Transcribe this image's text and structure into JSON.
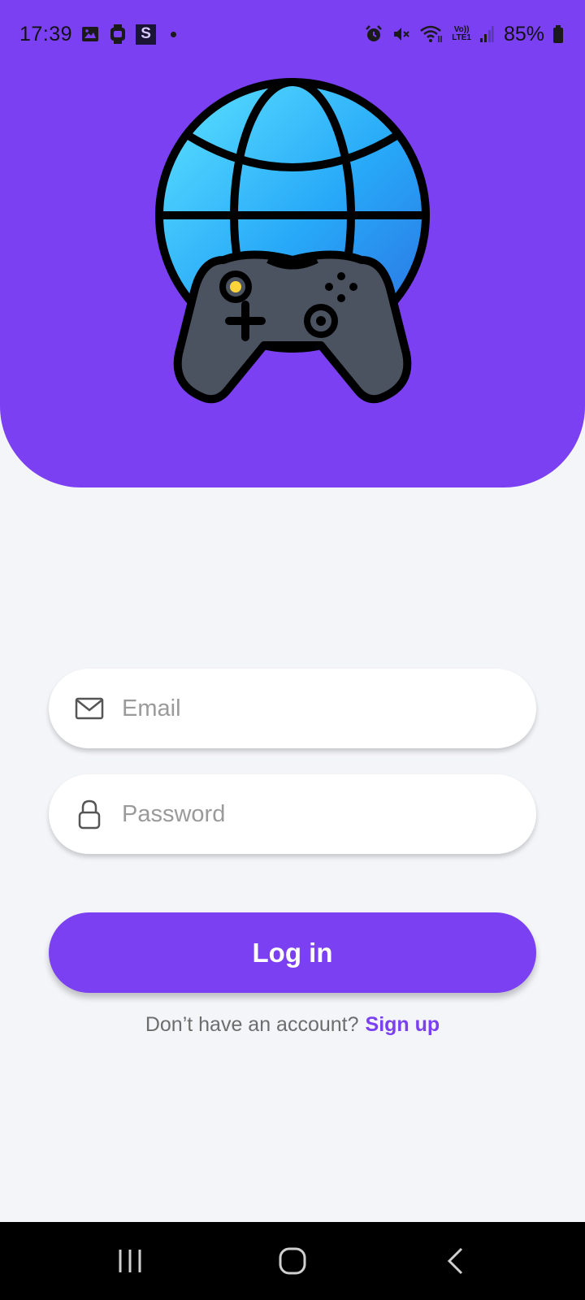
{
  "status_bar": {
    "time": "17:39",
    "battery": "85%",
    "icons_left": [
      "gallery-icon",
      "watch-icon",
      "s-app-icon",
      "notification-dot"
    ],
    "icons_right": [
      "alarm-icon",
      "mute-icon",
      "wifi-icon",
      "volte-icon",
      "signal-icon",
      "battery-icon"
    ],
    "s_badge": "S",
    "volte_top": "Vo))",
    "volte_bottom": "LTE1"
  },
  "header": {
    "background": "#7a40f2",
    "logo": "globe-gamepad-logo"
  },
  "form": {
    "email": {
      "placeholder": "Email",
      "value": "",
      "icon": "mail-icon"
    },
    "password": {
      "placeholder": "Password",
      "value": "",
      "icon": "lock-icon"
    },
    "login_label": "Log in"
  },
  "signup": {
    "prompt": "Don’t have an account?",
    "link": "Sign up"
  },
  "colors": {
    "accent": "#7a40f2",
    "background": "#f4f5f9"
  },
  "nav": {
    "items": [
      "recent-apps",
      "home",
      "back"
    ]
  }
}
